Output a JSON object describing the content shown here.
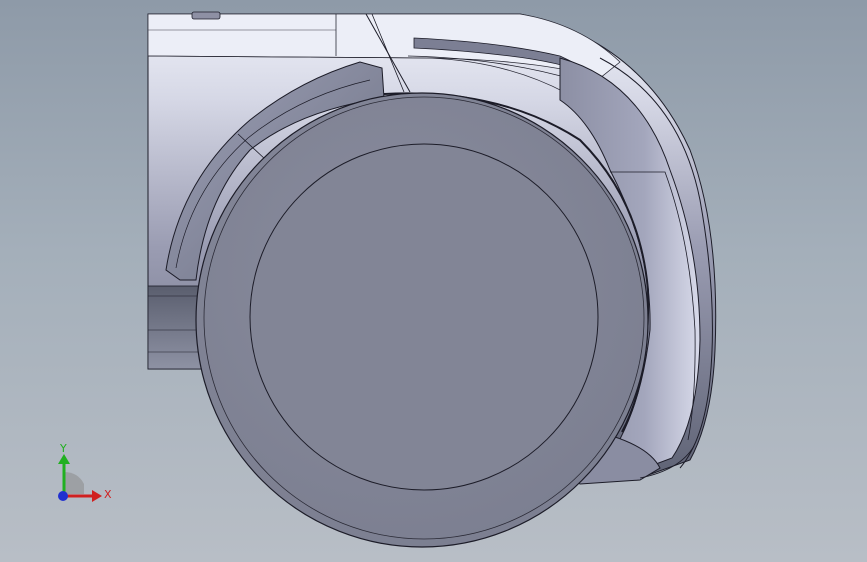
{
  "colors": {
    "background_top": "#b9c4cf",
    "background_bottom": "#aeb6be",
    "body_light": "#eceef6",
    "body_mid": "#a8aac0",
    "body_dark": "#4e5262",
    "tire_face": "#858898",
    "tire_sidewall": "#7a7d8e",
    "edge_line": "#1c1c28",
    "axis_x": "#d02020",
    "axis_y": "#20b020",
    "axis_z": "#2030d0"
  },
  "triad": {
    "x_label": "X",
    "y_label": "Y"
  }
}
